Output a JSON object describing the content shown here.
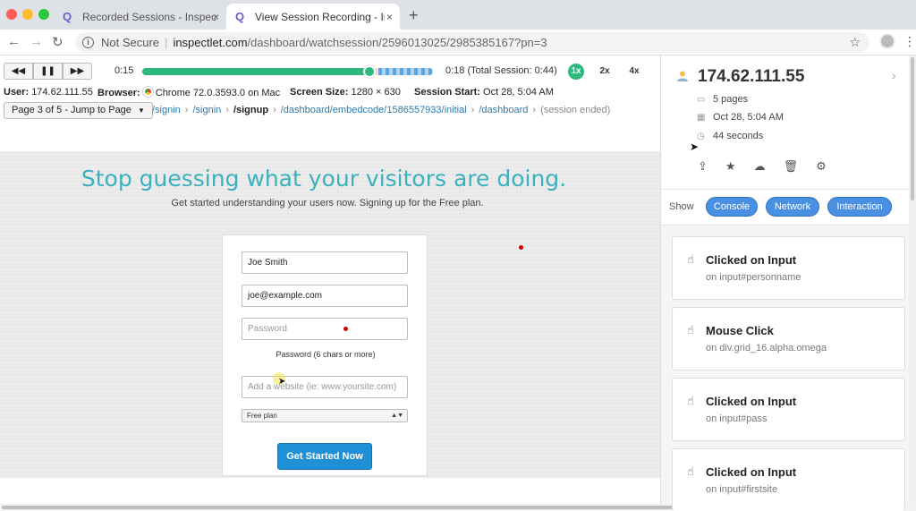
{
  "browser": {
    "tabs": [
      {
        "label": "Recorded Sessions - Inspectlet",
        "close": "×"
      },
      {
        "label": "View Session Recording - Inspectlet",
        "close": "×"
      }
    ],
    "new_tab": "+",
    "security_label": "Not Secure",
    "url_domain": "inspectlet.com",
    "url_path": "/dashboard/watchsession/2596013025/2985385167?pn=3"
  },
  "player": {
    "current_time": "0:15",
    "total_time": "0:18 (Total Session: 0:44)",
    "progress_fraction": 0.78,
    "speeds": [
      "1x",
      "2x",
      "4x"
    ],
    "user_label": "User:",
    "user_value": "174.62.111.55",
    "browser_label": "Browser:",
    "browser_value": "Chrome 72.0.3593.0 on Mac",
    "screen_label": "Screen Size:",
    "screen_value": "1280 × 630",
    "start_label": "Session Start:",
    "start_value": "Oct 28, 5:04 AM",
    "page_jump": "Page 3 of 5 - Jump to Page",
    "crumbs": [
      "/signin",
      "/signin",
      "/signup",
      "/dashboard/embedcode/1586557933/initial",
      "/dashboard"
    ],
    "crumbs_end": "(session ended)"
  },
  "recorded_page": {
    "headline": "Stop guessing what your visitors are doing.",
    "subline": "Get started understanding your users now. Signing up for the Free plan.",
    "name_value": "Joe Smith",
    "email_value": "joe@example.com",
    "password_placeholder": "Password",
    "password_hint": "Password (6 chars or more)",
    "website_placeholder": "Add a website (ie: www.yoursite.com)",
    "plan_value": "Free plan",
    "submit_label": "Get Started Now"
  },
  "session": {
    "ip": "174.62.111.55",
    "pages": "5 pages",
    "date": "Oct 28, 5:04 AM",
    "duration": "44 seconds",
    "show_label": "Show",
    "filters": [
      "Console",
      "Network",
      "Interaction"
    ],
    "events": [
      {
        "title": "Clicked on Input",
        "target": "on input#personname"
      },
      {
        "title": "Mouse Click",
        "target": "on div.grid_16.alpha.omega"
      },
      {
        "title": "Clicked on Input",
        "target": "on input#pass"
      },
      {
        "title": "Clicked on Input",
        "target": "on input#firstsite"
      }
    ]
  }
}
